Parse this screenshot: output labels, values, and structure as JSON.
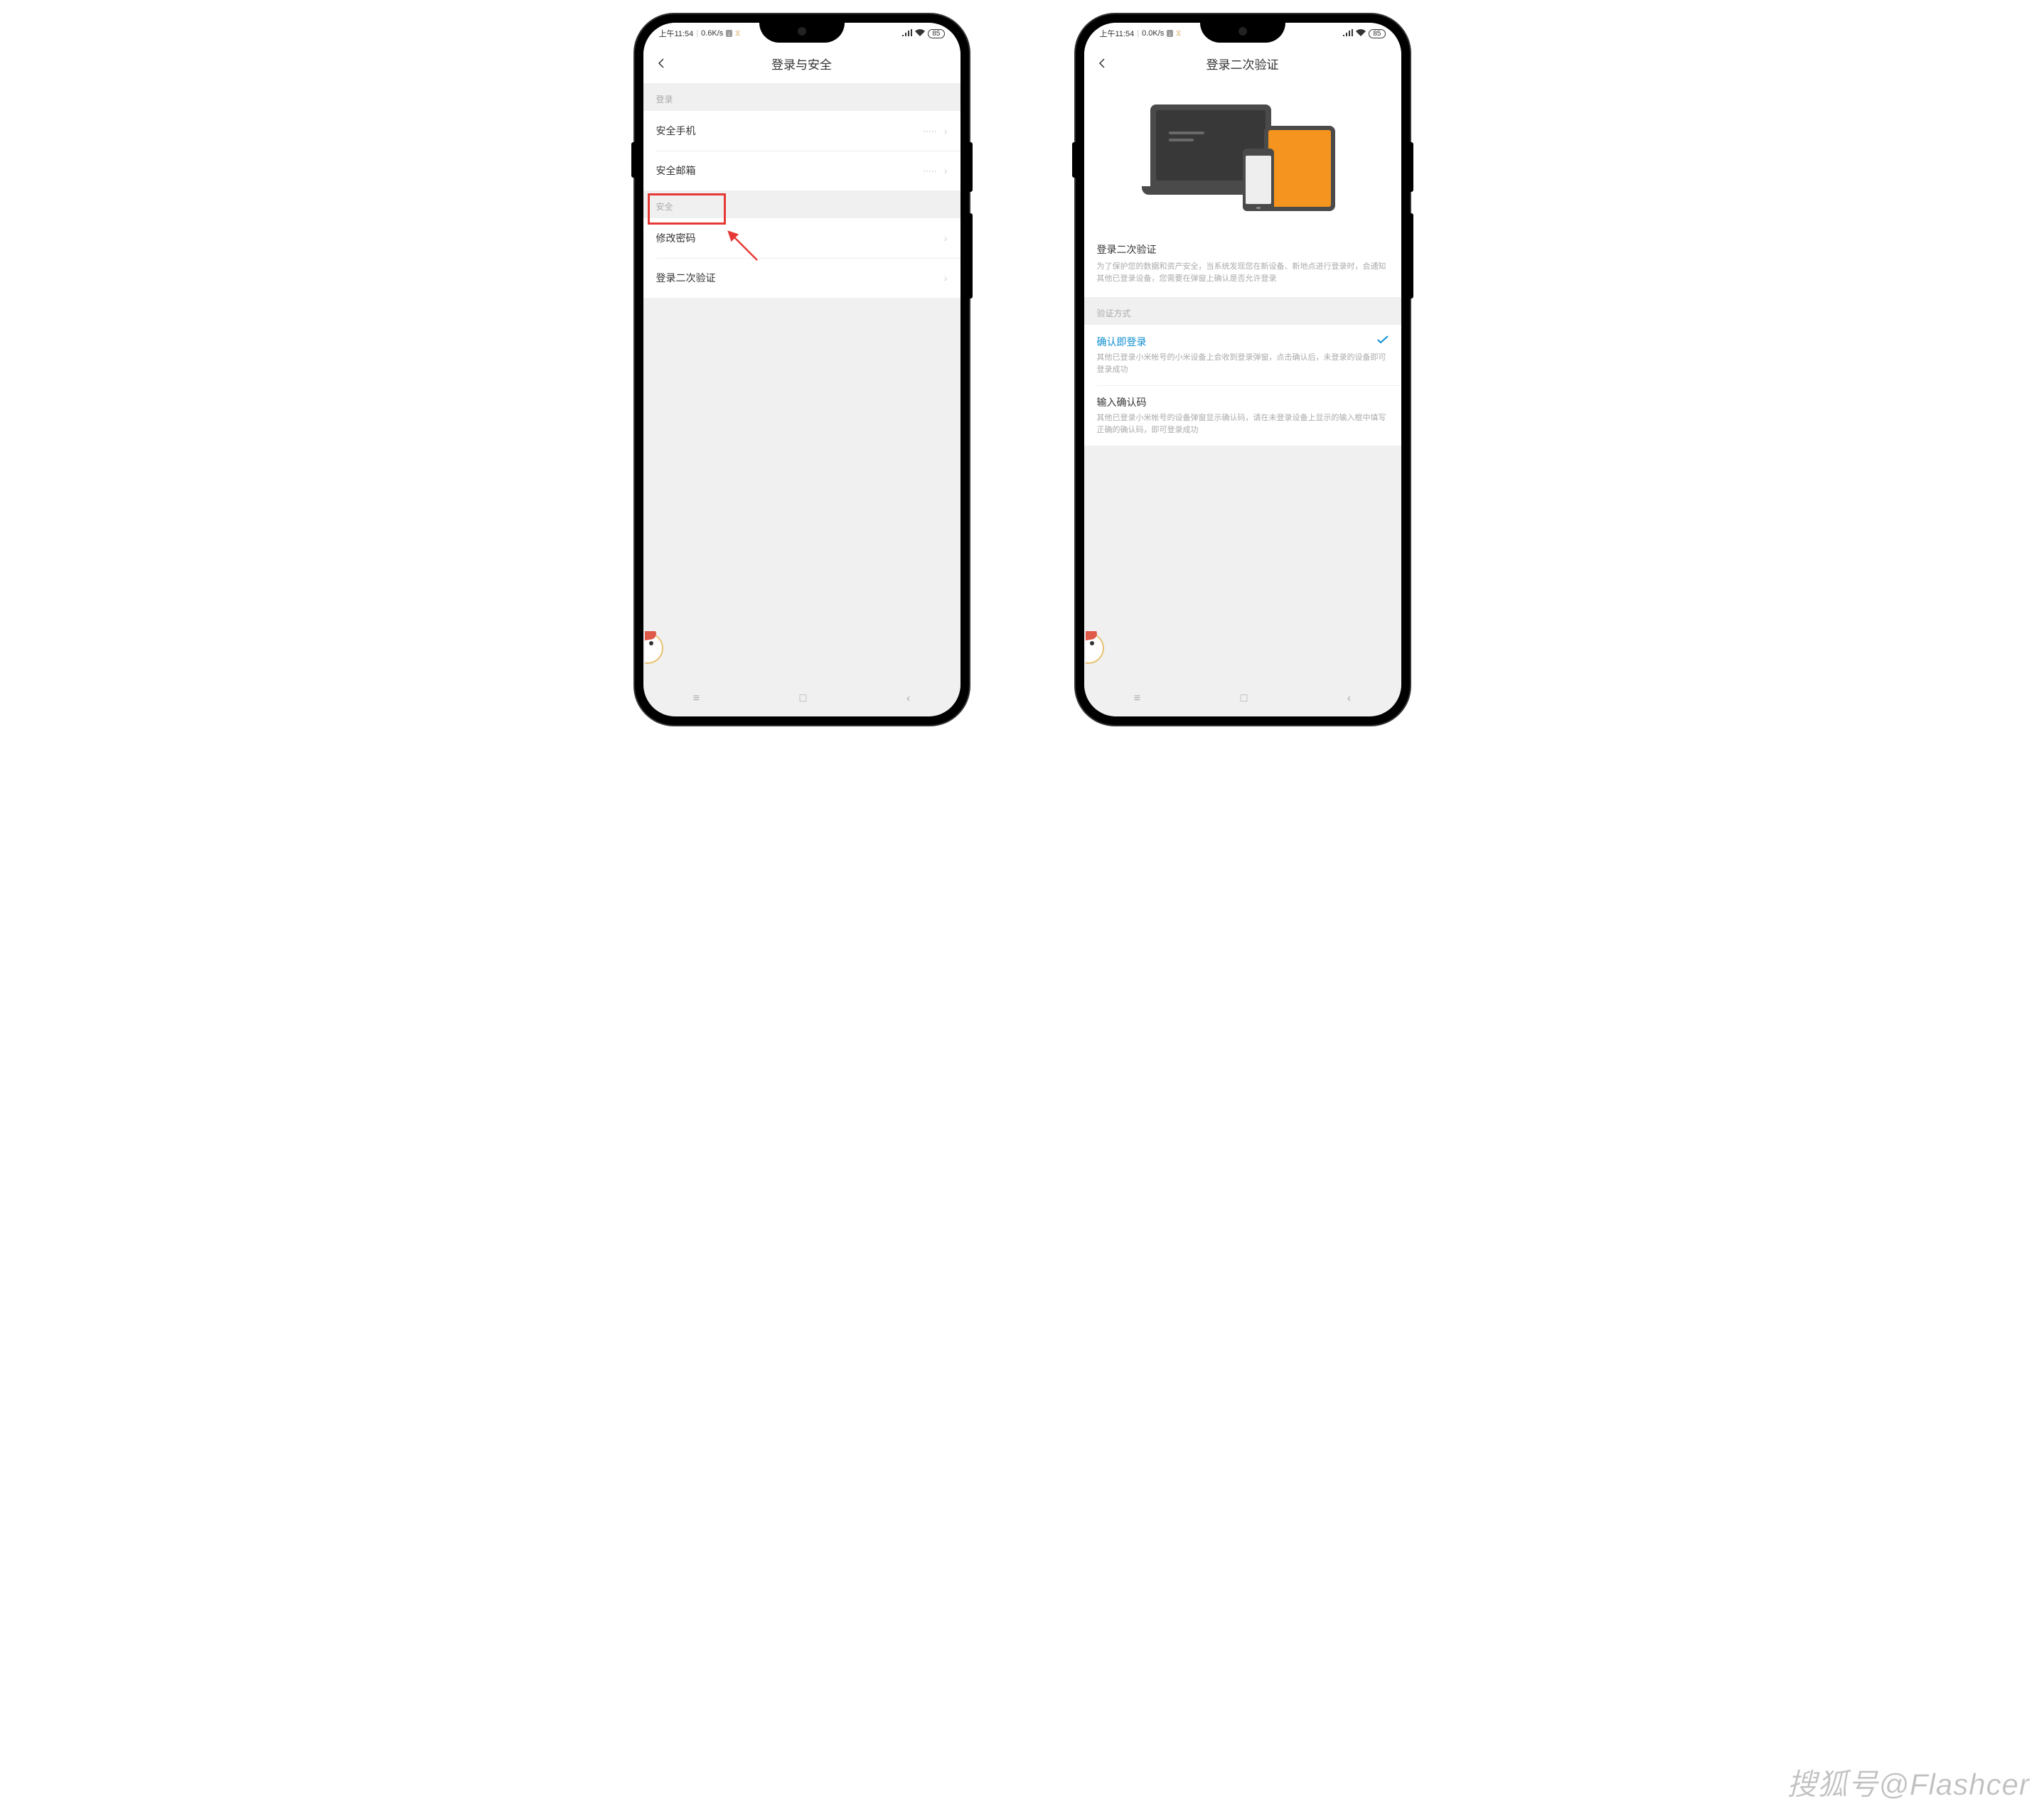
{
  "status": {
    "time": "上午11:54",
    "net_l": "0.6K/s",
    "net_r": "0.0K/s",
    "down_icon": "↓",
    "hourglass": "⧗",
    "signal": "ılıl",
    "wifi": "⬿",
    "battery": "85"
  },
  "left_phone": {
    "title": "登录与安全",
    "section_login": "登录",
    "section_security": "安全",
    "items": {
      "phone": {
        "label": "安全手机",
        "value": "·····"
      },
      "email": {
        "label": "安全邮箱",
        "value": "·····"
      },
      "password": {
        "label": "修改密码"
      },
      "twofa": {
        "label": "登录二次验证"
      }
    }
  },
  "right_phone": {
    "title": "登录二次验证",
    "info": {
      "title": "登录二次验证",
      "desc": "为了保护您的数据和资产安全，当系统发现您在新设备、新地点进行登录时，会通知其他已登录设备，您需要在弹窗上确认是否允许登录"
    },
    "section_method": "验证方式",
    "option_confirm": {
      "title": "确认即登录",
      "desc": "其他已登录小米帐号的小米设备上会收到登录弹窗，点击确认后，未登录的设备即可登录成功"
    },
    "option_code": {
      "title": "输入确认码",
      "desc": "其他已登录小米帐号的设备弹窗显示确认码，请在未登录设备上显示的输入框中填写正确的确认码，即可登录成功"
    }
  },
  "watermark": "搜狐号@Flashcer",
  "nav": {
    "menu": "≡",
    "home": "□",
    "back": "‹"
  }
}
